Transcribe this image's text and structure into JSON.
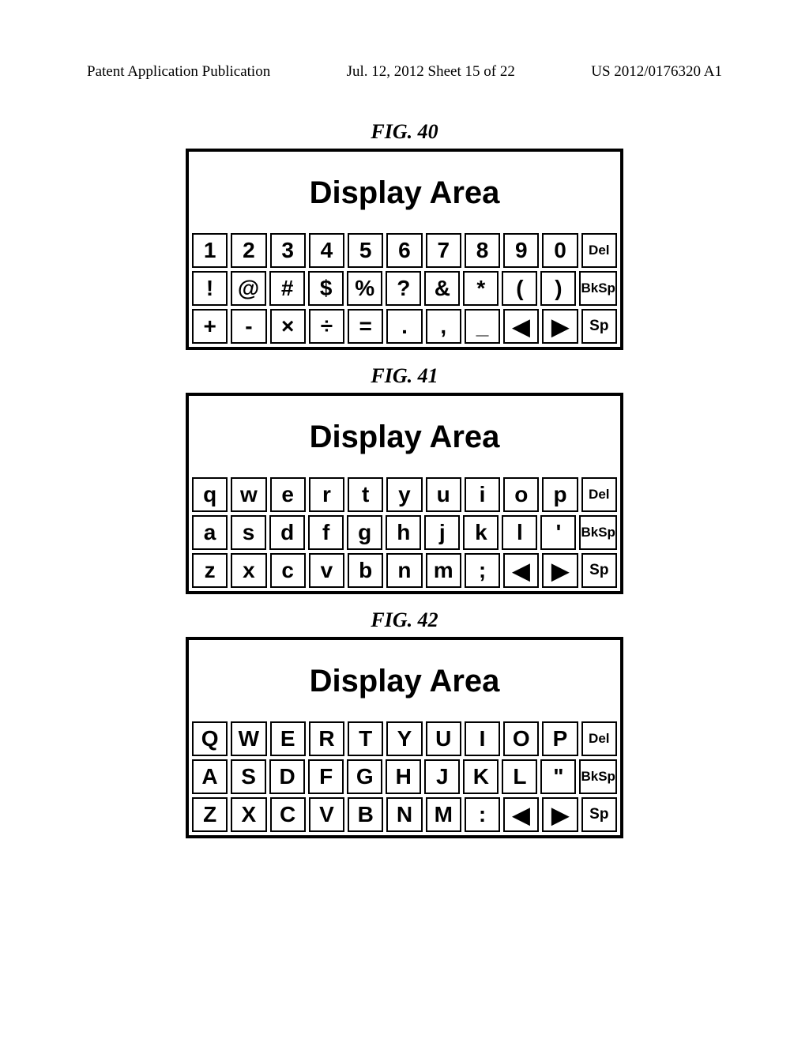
{
  "header": {
    "left": "Patent Application Publication",
    "center": "Jul. 12, 2012   Sheet 15 of 22",
    "right": "US 2012/0176320 A1"
  },
  "figures": [
    {
      "label": "FIG. 40",
      "display": "Display Area",
      "rows": [
        [
          "1",
          "2",
          "3",
          "4",
          "5",
          "6",
          "7",
          "8",
          "9",
          "0",
          "Del"
        ],
        [
          "!",
          "@",
          "#",
          "$",
          "%",
          "?",
          "&",
          "*",
          "(",
          ")",
          "BkSp"
        ],
        [
          "+",
          "-",
          "×",
          "÷",
          "=",
          ".",
          ",",
          "_",
          "◀",
          "▶",
          "Sp"
        ]
      ]
    },
    {
      "label": "FIG. 41",
      "display": "Display Area",
      "rows": [
        [
          "q",
          "w",
          "e",
          "r",
          "t",
          "y",
          "u",
          "i",
          "o",
          "p",
          "Del"
        ],
        [
          "a",
          "s",
          "d",
          "f",
          "g",
          "h",
          "j",
          "k",
          "l",
          "'",
          "BkSp"
        ],
        [
          "z",
          "x",
          "c",
          "v",
          "b",
          "n",
          "m",
          ";",
          "◀",
          "▶",
          "Sp"
        ]
      ]
    },
    {
      "label": "FIG. 42",
      "display": "Display Area",
      "rows": [
        [
          "Q",
          "W",
          "E",
          "R",
          "T",
          "Y",
          "U",
          "I",
          "O",
          "P",
          "Del"
        ],
        [
          "A",
          "S",
          "D",
          "F",
          "G",
          "H",
          "J",
          "K",
          "L",
          "\"",
          "BkSp"
        ],
        [
          "Z",
          "X",
          "C",
          "V",
          "B",
          "N",
          "M",
          ":",
          "◀",
          "▶",
          "Sp"
        ]
      ]
    }
  ]
}
